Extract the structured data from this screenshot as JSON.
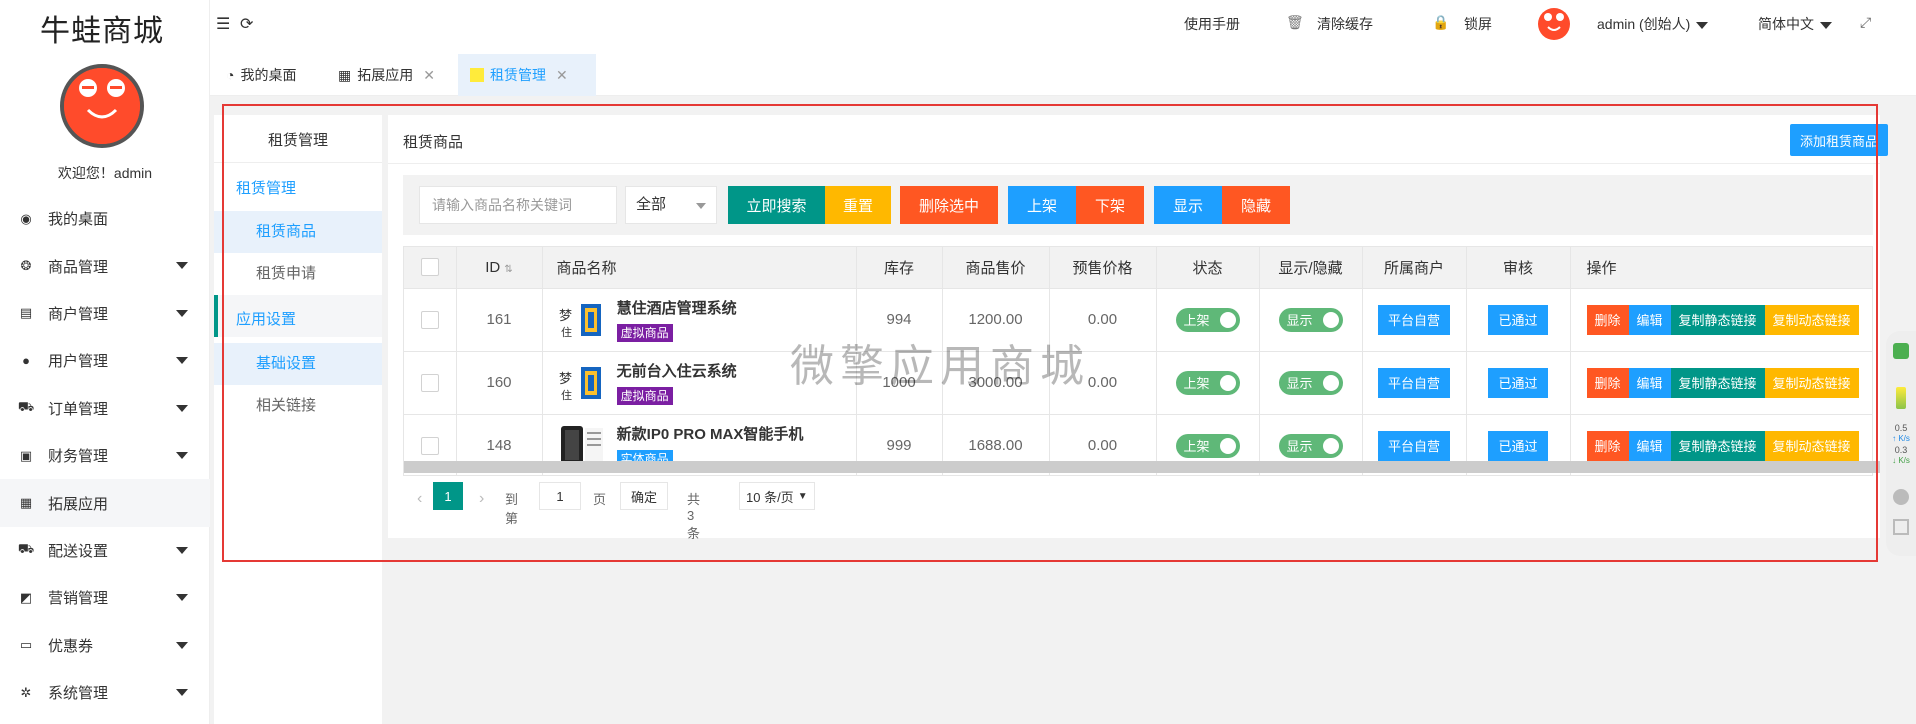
{
  "app": {
    "title": "牛蛙商城",
    "welcome": "欢迎您！admin"
  },
  "sidebar": {
    "items": [
      {
        "label": "我的桌面",
        "icon": "dashboard-icon",
        "caret": false
      },
      {
        "label": "商品管理",
        "icon": "goods-icon",
        "caret": true
      },
      {
        "label": "商户管理",
        "icon": "store-icon",
        "caret": true
      },
      {
        "label": "用户管理",
        "icon": "user-icon",
        "caret": true
      },
      {
        "label": "订单管理",
        "icon": "cart-icon",
        "caret": true
      },
      {
        "label": "财务管理",
        "icon": "money-icon",
        "caret": true
      },
      {
        "label": "拓展应用",
        "icon": "grid-icon",
        "caret": false
      },
      {
        "label": "配送设置",
        "icon": "truck-icon",
        "caret": true
      },
      {
        "label": "营销管理",
        "icon": "marketing-icon",
        "caret": true
      },
      {
        "label": "优惠券",
        "icon": "coupon-icon",
        "caret": true
      },
      {
        "label": "系统管理",
        "icon": "gear-icon",
        "caret": true
      }
    ]
  },
  "header": {
    "manual": "使用手册",
    "clear_cache": "清除缓存",
    "lock": "锁屏",
    "user": "admin (创始人)",
    "language": "简体中文"
  },
  "tabs": [
    {
      "label": "我的桌面"
    },
    {
      "label": "拓展应用"
    },
    {
      "label": "租赁管理"
    }
  ],
  "subnav": {
    "title": "租赁管理",
    "group1": "租赁管理",
    "items1": [
      "租赁商品",
      "租赁申请"
    ],
    "group2": "应用设置",
    "items2": [
      "基础设置",
      "相关链接"
    ]
  },
  "content": {
    "title": "租赁商品",
    "add_button": "添加租赁商品",
    "search_placeholder": "请输入商品名称关键词",
    "filter_value": "全部",
    "buttons": {
      "search": "立即搜索",
      "reset": "重置",
      "delete_selected": "删除选中",
      "on_shelf": "上架",
      "off_shelf": "下架",
      "show": "显示",
      "hide": "隐藏"
    }
  },
  "table": {
    "columns": [
      "ID",
      "商品名称",
      "库存",
      "商品售价",
      "预售价格",
      "状态",
      "显示/隐藏",
      "所属商户",
      "审核",
      "操作"
    ],
    "rows": [
      {
        "id": "161",
        "name": "慧住酒店管理系统",
        "tag": "虚拟商品",
        "stock": "994",
        "price": "1200.00",
        "presale": "0.00",
        "status": "上架",
        "visible": "显示",
        "merchant": "平台自营",
        "audit": "已通过"
      },
      {
        "id": "160",
        "name": "无前台入住云系统",
        "tag": "虚拟商品",
        "stock": "1000",
        "price": "3000.00",
        "presale": "0.00",
        "status": "上架",
        "visible": "显示",
        "merchant": "平台自营",
        "audit": "已通过"
      },
      {
        "id": "148",
        "name": "新款IP0 PRO MAX智能手机",
        "tag": "实体商品",
        "stock": "999",
        "price": "1688.00",
        "presale": "0.00",
        "status": "上架",
        "visible": "显示",
        "merchant": "平台自营",
        "audit": "已通过"
      }
    ],
    "ops": [
      "删除",
      "编辑",
      "复制静态链接",
      "复制动态链接"
    ]
  },
  "pager": {
    "current": "1",
    "goto_label": "到第",
    "goto_value": "1",
    "page_label": "页",
    "confirm": "确定",
    "total": "共 3 条",
    "per_page": "10 条/页"
  },
  "watermark": "微擎应用商城",
  "widget": {
    "speed_up": "0.5",
    "speed_down": "0.3",
    "unit": "K/s"
  },
  "colors": {
    "blue": "#1e9fff",
    "green": "#009688",
    "orange": "#ffb800",
    "red": "#ff5722",
    "switch": "#5fb878",
    "virtual_tag": "#7b1fa2"
  }
}
